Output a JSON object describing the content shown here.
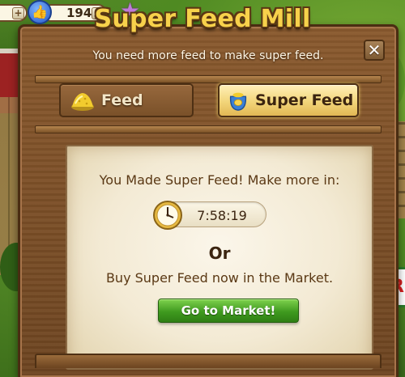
{
  "hud": {
    "thumbs_count": "194",
    "left_plus": "+",
    "thumbs_plus": "+",
    "icons": [
      "thumbs-up-icon",
      "star-icon"
    ]
  },
  "dialog": {
    "title": "Super Feed Mill",
    "subtitle": "You need more feed to make super feed.",
    "close_label": "✕",
    "tabs": [
      {
        "label": "Feed",
        "icon": "feed-pile-icon",
        "selected": false
      },
      {
        "label": "Super Feed",
        "icon": "super-feed-sack-icon",
        "selected": true
      }
    ],
    "panel": {
      "message": "You Made Super Feed! Make more in:",
      "timer": "7:58:19",
      "timer_icon": "clock-icon",
      "or_text": "Or",
      "buy_message": "Buy Super Feed now in the Market.",
      "market_button": "Go to Market!"
    }
  },
  "colors": {
    "title_gold": "#f7d14b",
    "wood": "#7a5129",
    "parchment": "#f3ead4",
    "market_green": "#3f9a1f"
  }
}
